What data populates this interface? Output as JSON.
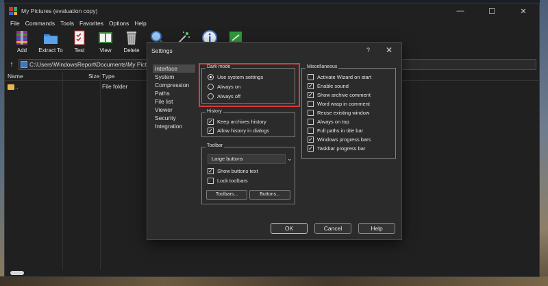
{
  "window": {
    "title": "My Pictures (evaluation copy)",
    "minimize": "—",
    "maximize": "☐",
    "close": "✕"
  },
  "menu": [
    "File",
    "Commands",
    "Tools",
    "Favorites",
    "Options",
    "Help"
  ],
  "toolbar": [
    {
      "label": "Add",
      "icon": "add-archive-icon"
    },
    {
      "label": "Extract To",
      "icon": "extract-folder-icon"
    },
    {
      "label": "Test",
      "icon": "test-checklist-icon"
    },
    {
      "label": "View",
      "icon": "view-book-icon"
    },
    {
      "label": "Delete",
      "icon": "trash-icon"
    },
    {
      "label": "",
      "icon": "find-magnifier-icon"
    },
    {
      "label": "",
      "icon": "wizard-wand-icon"
    },
    {
      "label": "",
      "icon": "info-icon"
    },
    {
      "label": "",
      "icon": "repair-kit-icon"
    }
  ],
  "address": {
    "path": "C:\\Users\\WindowsReport\\Documents\\My Pictures"
  },
  "columns": {
    "name": "Name",
    "size": "Size",
    "type": "Type"
  },
  "rows": [
    {
      "name": "..",
      "type": "File folder"
    }
  ],
  "settings": {
    "title": "Settings",
    "help": "?",
    "close": "✕",
    "nav": [
      "Interface",
      "System",
      "Compression",
      "Paths",
      "File list",
      "Viewer",
      "Security",
      "Integration"
    ],
    "selected_nav": "Interface",
    "dark_mode": {
      "title": "Dark mode",
      "options": [
        "Use system settings",
        "Always on",
        "Always off"
      ],
      "selected": "Use system settings"
    },
    "history": {
      "title": "History",
      "options": [
        {
          "label": "Keep archives history",
          "checked": true
        },
        {
          "label": "Allow history in dialogs",
          "checked": true
        }
      ]
    },
    "toolbar_group": {
      "title": "Toolbar",
      "size_value": "Large buttons",
      "options": [
        {
          "label": "Show buttons text",
          "checked": true
        },
        {
          "label": "Lock toolbars",
          "checked": false
        }
      ],
      "toolbars_button": "Toolbars...",
      "buttons_button": "Buttons..."
    },
    "misc": {
      "title": "Miscellaneous",
      "options": [
        {
          "label": "Activate Wizard on start",
          "checked": false
        },
        {
          "label": "Enable sound",
          "checked": true
        },
        {
          "label": "Show archive comment",
          "checked": true
        },
        {
          "label": "Word wrap in comment",
          "checked": false
        },
        {
          "label": "Reuse existing window",
          "checked": false
        },
        {
          "label": "Always on top",
          "checked": false
        },
        {
          "label": "Full paths in title bar",
          "checked": false
        },
        {
          "label": "Windows progress bars",
          "checked": true
        },
        {
          "label": "Taskbar progress bar",
          "checked": true
        }
      ]
    },
    "ok": "OK",
    "cancel": "Cancel",
    "help_button": "Help"
  },
  "colors": {
    "highlight": "#d93b3b",
    "background": "#202020",
    "dialog": "#2b2b2b"
  }
}
